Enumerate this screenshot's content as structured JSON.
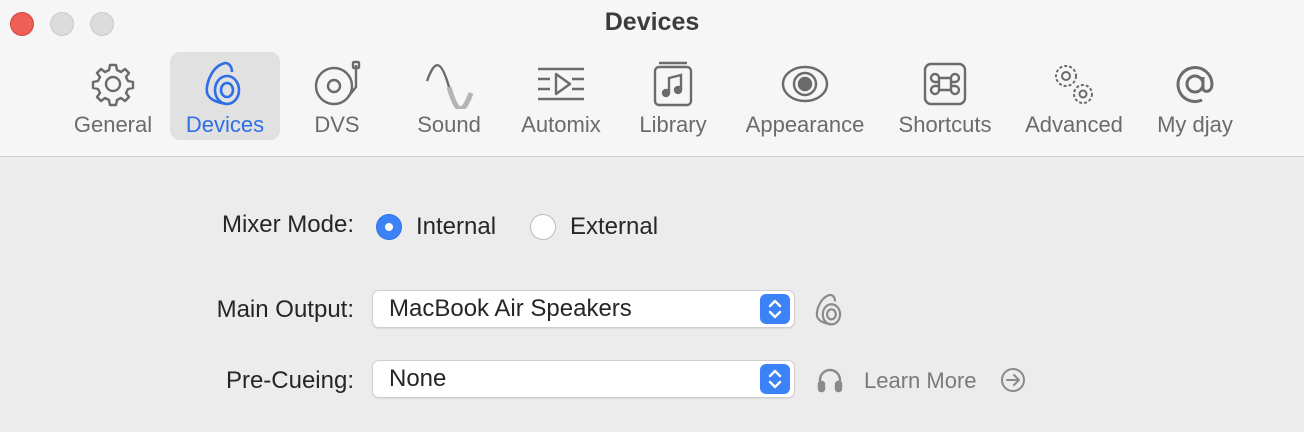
{
  "window": {
    "title": "Devices"
  },
  "tabs": [
    {
      "label": "General",
      "icon": "gear-icon"
    },
    {
      "label": "Devices",
      "icon": "speaker-icon",
      "selected": true
    },
    {
      "label": "DVS",
      "icon": "turntable-icon"
    },
    {
      "label": "Sound",
      "icon": "waveform-icon"
    },
    {
      "label": "Automix",
      "icon": "automix-icon"
    },
    {
      "label": "Library",
      "icon": "music-library-icon"
    },
    {
      "label": "Appearance",
      "icon": "eye-icon"
    },
    {
      "label": "Shortcuts",
      "icon": "command-key-icon"
    },
    {
      "label": "Advanced",
      "icon": "gears-icon"
    },
    {
      "label": "My djay",
      "icon": "at-sign-icon"
    }
  ],
  "mixer_mode": {
    "label": "Mixer Mode:",
    "options": [
      {
        "label": "Internal",
        "selected": true
      },
      {
        "label": "External",
        "selected": false
      }
    ]
  },
  "main_output": {
    "label": "Main Output:",
    "value": "MacBook Air Speakers",
    "aux_icon": "speaker-icon"
  },
  "pre_cueing": {
    "label": "Pre-Cueing:",
    "value": "None",
    "aux_icon": "headphones-icon",
    "link_label": "Learn More",
    "link_icon": "arrow-circle-icon"
  },
  "colors": {
    "accent": "#3b82f6",
    "selected_tab_text": "#2e6ee6",
    "close": "#ee5f57"
  }
}
